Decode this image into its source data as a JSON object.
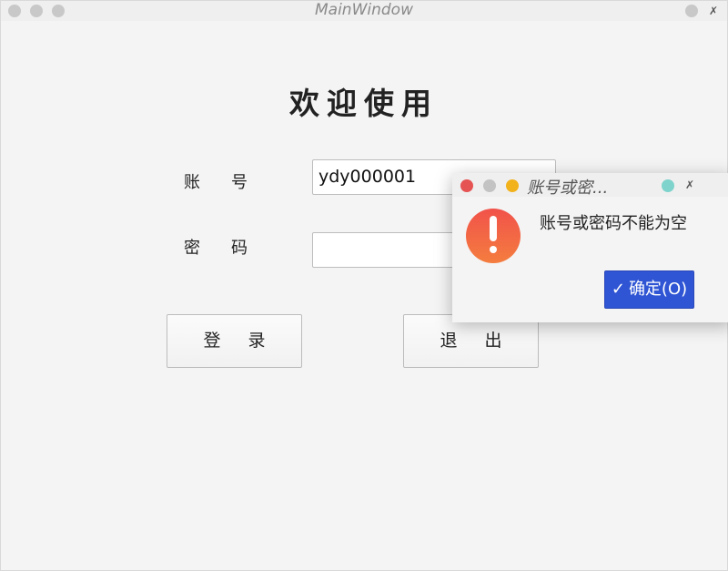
{
  "window": {
    "title": "MainWindow"
  },
  "form": {
    "welcome_text": "欢迎使用",
    "account_label": "账号",
    "account_value": "ydy000001",
    "password_label": "密码",
    "password_value": "",
    "login_button": "登录",
    "exit_button": "退出"
  },
  "dialog": {
    "title": "账号或密...",
    "message": "账号或密码不能为空",
    "ok_button": "确定(O)",
    "ok_icon": "checkmark-icon",
    "warning_icon": "exclamation-icon",
    "colors": {
      "close_dot": "#e55353",
      "min_dot": "#c3c3c3",
      "max_dot": "#f2b21c",
      "pin_dot": "#7ed3cc",
      "ok_button": "#2f55d4",
      "warning": "#f26548"
    }
  }
}
